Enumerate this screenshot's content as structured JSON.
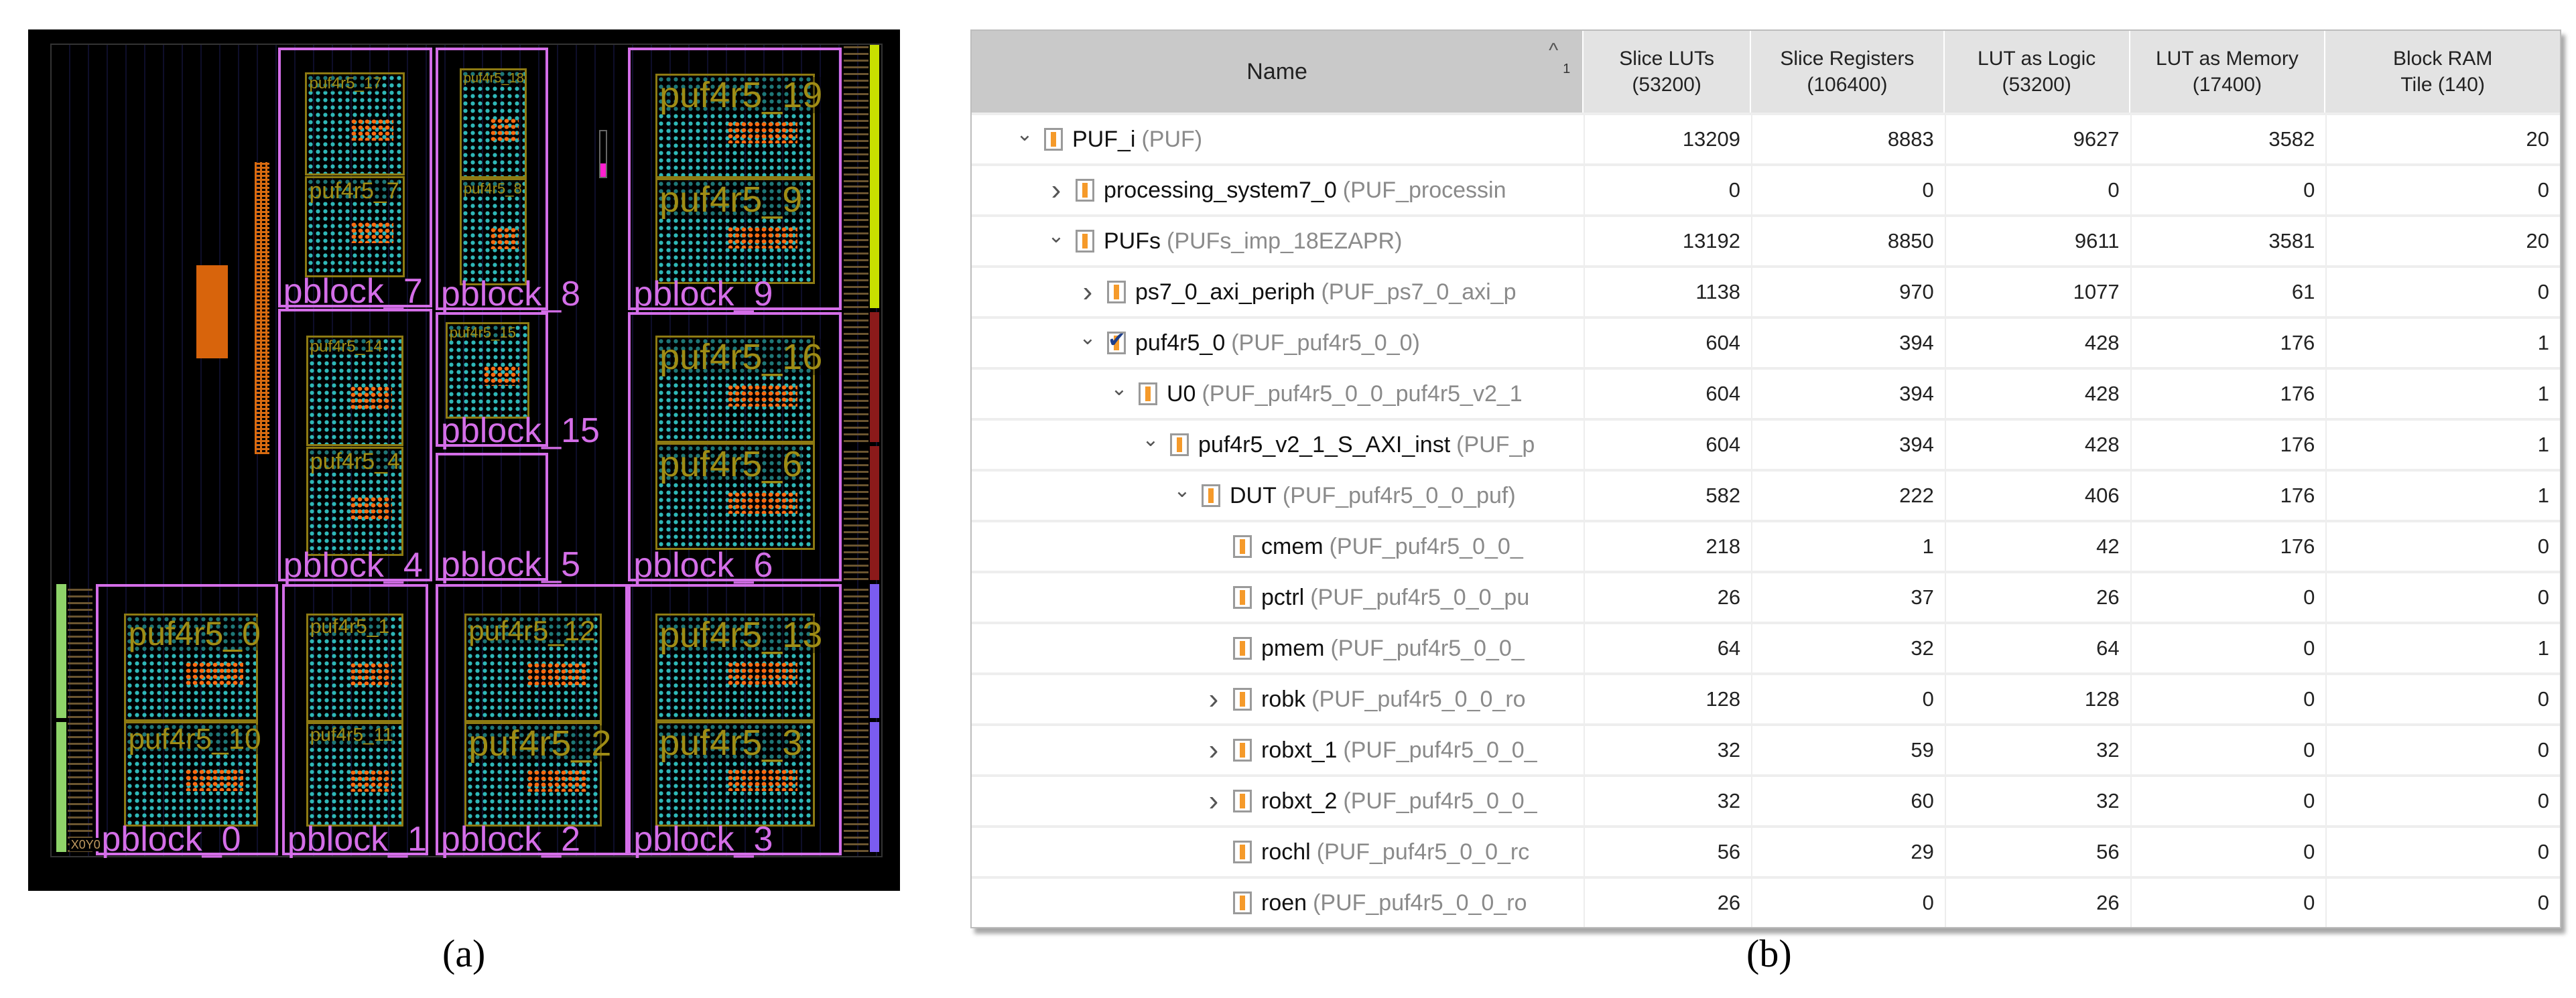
{
  "figure": {
    "captions": {
      "a": "(a)",
      "b": "(b)"
    }
  },
  "fpga_view": {
    "origin_label": "X0Y0",
    "pblocks": [
      "pblock_7",
      "pblock_8",
      "pblock_9",
      "pblock_4",
      "pblock_15",
      "pblock_5",
      "pblock_6",
      "pblock_0",
      "pblock_1",
      "pblock_2",
      "pblock_3"
    ],
    "pufs": [
      "puf4r5_17",
      "puf4r5_7",
      "puf4r5_18",
      "puf4r5_8",
      "puf4r5_19",
      "puf4r5_9",
      "puf4r5_14",
      "puf4r5_4",
      "puf4r5_15",
      "puf4r5_16",
      "puf4r5_6",
      "puf4r5_0",
      "puf4r5_10",
      "puf4r5_1",
      "puf4r5_11",
      "puf4r5_12",
      "puf4r5_2",
      "puf4r5_13",
      "puf4r5_3"
    ],
    "colors": {
      "pblock": "#d46ee8",
      "puf": "#8d7a12",
      "cells": "#2fb8b8",
      "ram": "#ff6a10",
      "background": "#000000"
    }
  },
  "utilization_table": {
    "columns": [
      {
        "label": "Name",
        "sort_indicator": "^",
        "sort_order": "1"
      },
      {
        "label": "Slice LUTs\n(53200)"
      },
      {
        "label": "Slice Registers\n(106400)"
      },
      {
        "label": "LUT as Logic\n(53200)"
      },
      {
        "label": "LUT as Memory\n(17400)"
      },
      {
        "label": "Block RAM\nTile (140)"
      }
    ],
    "rows": [
      {
        "name": "PUF_i",
        "type": "(PUF)",
        "level": 0,
        "expand": "down",
        "icon": "instance",
        "values": [
          "13209",
          "8883",
          "9627",
          "3582",
          "20"
        ]
      },
      {
        "name": "processing_system7_0",
        "type": "(PUF_processin",
        "level": 1,
        "expand": "right",
        "icon": "instance",
        "values": [
          "0",
          "0",
          "0",
          "0",
          "0"
        ]
      },
      {
        "name": "PUFs",
        "type": "(PUFs_imp_18EZAPR)",
        "level": 1,
        "expand": "down",
        "icon": "instance",
        "values": [
          "13192",
          "8850",
          "9611",
          "3581",
          "20"
        ]
      },
      {
        "name": "ps7_0_axi_periph",
        "type": "(PUF_ps7_0_axi_p",
        "level": 2,
        "expand": "right",
        "icon": "instance",
        "values": [
          "1138",
          "970",
          "1077",
          "61",
          "0"
        ]
      },
      {
        "name": "puf4r5_0",
        "type": "(PUF_puf4r5_0_0)",
        "level": 2,
        "expand": "down",
        "icon": "checked",
        "values": [
          "604",
          "394",
          "428",
          "176",
          "1"
        ]
      },
      {
        "name": "U0",
        "type": "(PUF_puf4r5_0_0_puf4r5_v2_1",
        "level": 3,
        "expand": "down",
        "icon": "instance",
        "values": [
          "604",
          "394",
          "428",
          "176",
          "1"
        ]
      },
      {
        "name": "puf4r5_v2_1_S_AXI_inst",
        "type": "(PUF_p",
        "level": 4,
        "expand": "down",
        "icon": "instance",
        "values": [
          "604",
          "394",
          "428",
          "176",
          "1"
        ]
      },
      {
        "name": "DUT",
        "type": "(PUF_puf4r5_0_0_puf)",
        "level": 5,
        "expand": "down",
        "icon": "instance",
        "values": [
          "582",
          "222",
          "406",
          "176",
          "1"
        ]
      },
      {
        "name": "cmem",
        "type": "(PUF_puf4r5_0_0_",
        "level": 6,
        "expand": "none",
        "icon": "instance",
        "values": [
          "218",
          "1",
          "42",
          "176",
          "0"
        ]
      },
      {
        "name": "pctrl",
        "type": "(PUF_puf4r5_0_0_pu",
        "level": 6,
        "expand": "none",
        "icon": "instance",
        "values": [
          "26",
          "37",
          "26",
          "0",
          "0"
        ]
      },
      {
        "name": "pmem",
        "type": "(PUF_puf4r5_0_0_",
        "level": 6,
        "expand": "none",
        "icon": "instance",
        "values": [
          "64",
          "32",
          "64",
          "0",
          "1"
        ]
      },
      {
        "name": "robk",
        "type": "(PUF_puf4r5_0_0_ro",
        "level": 6,
        "expand": "right",
        "icon": "instance",
        "values": [
          "128",
          "0",
          "128",
          "0",
          "0"
        ]
      },
      {
        "name": "robxt_1",
        "type": "(PUF_puf4r5_0_0_",
        "level": 6,
        "expand": "right",
        "icon": "instance",
        "values": [
          "32",
          "59",
          "32",
          "0",
          "0"
        ]
      },
      {
        "name": "robxt_2",
        "type": "(PUF_puf4r5_0_0_",
        "level": 6,
        "expand": "right",
        "icon": "instance",
        "values": [
          "32",
          "60",
          "32",
          "0",
          "0"
        ]
      },
      {
        "name": "rochl",
        "type": "(PUF_puf4r5_0_0_rc",
        "level": 6,
        "expand": "none",
        "icon": "instance",
        "values": [
          "56",
          "29",
          "56",
          "0",
          "0"
        ]
      },
      {
        "name": "roen",
        "type": "(PUF_puf4r5_0_0_ro",
        "level": 6,
        "expand": "none",
        "icon": "instance",
        "values": [
          "26",
          "0",
          "26",
          "0",
          "0"
        ]
      }
    ]
  }
}
